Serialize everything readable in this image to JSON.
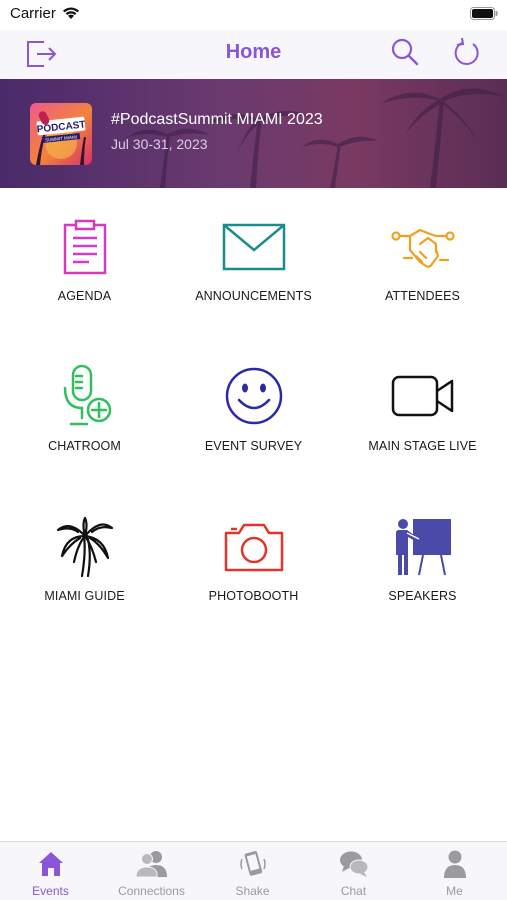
{
  "status_bar": {
    "carrier": "Carrier"
  },
  "nav": {
    "title": "Home"
  },
  "event": {
    "title": "#PodcastSummit MIAMI 2023",
    "dates": "Jul 30-31, 2023",
    "logo_text": "PODCAST",
    "logo_subtext": "SUMMIT MIAMI"
  },
  "tiles": [
    {
      "label": "AGENDA",
      "icon": "clipboard-icon",
      "color": "#d63bbf"
    },
    {
      "label": "ANNOUNCEMENTS",
      "icon": "envelope-icon",
      "color": "#1a8c8c"
    },
    {
      "label": "ATTENDEES",
      "icon": "handshake-icon",
      "color": "#f0a020"
    },
    {
      "label": "CHATROOM",
      "icon": "microphone-plus-icon",
      "color": "#2fbf5f"
    },
    {
      "label": "EVENT SURVEY",
      "icon": "smiley-icon",
      "color": "#2a2aa8"
    },
    {
      "label": "MAIN STAGE LIVE",
      "icon": "video-camera-icon",
      "color": "#111111"
    },
    {
      "label": "MIAMI GUIDE",
      "icon": "palm-tree-icon",
      "color": "#111111"
    },
    {
      "label": "PHOTOBOOTH",
      "icon": "camera-icon",
      "color": "#e0352b"
    },
    {
      "label": "SPEAKERS",
      "icon": "presenter-icon",
      "color": "#4a4aa8"
    }
  ],
  "tabs": [
    {
      "label": "Events",
      "icon": "home-icon",
      "active": true
    },
    {
      "label": "Connections",
      "icon": "people-icon",
      "active": false
    },
    {
      "label": "Shake",
      "icon": "shake-phone-icon",
      "active": false
    },
    {
      "label": "Chat",
      "icon": "chat-bubbles-icon",
      "active": false
    },
    {
      "label": "Me",
      "icon": "person-icon",
      "active": false
    }
  ],
  "colors": {
    "accent": "#8a55d6",
    "nav_background": "#f7f6fb",
    "inactive_tab": "#9a9a9f"
  }
}
